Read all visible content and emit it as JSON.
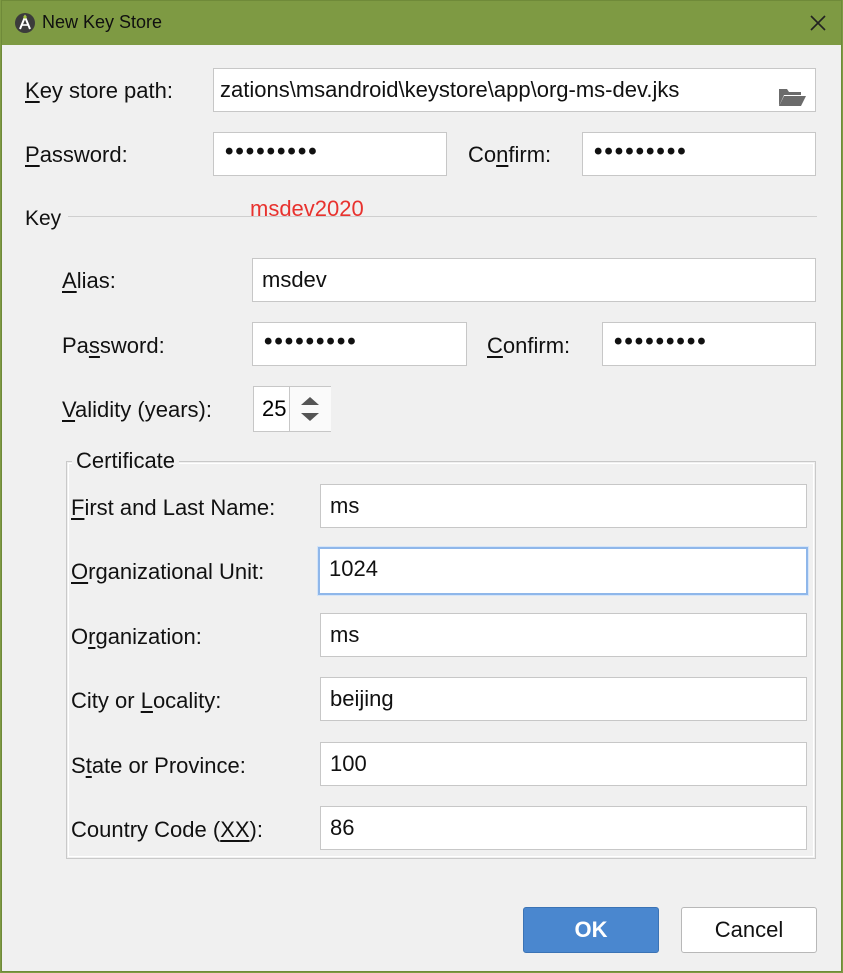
{
  "window": {
    "title": "New Key Store"
  },
  "keystore": {
    "path_label_prefix": "",
    "path_label_mnemonic": "K",
    "path_label_rest": "ey store path:",
    "path_value": "zations\\msandroid\\keystore\\app\\org-ms-dev.jks",
    "password_label_mnemonic": "P",
    "password_label_rest": "assword:",
    "password_value": "•••••••••",
    "confirm_label_a": "Co",
    "confirm_label_mnemonic": "n",
    "confirm_label_b": "firm:",
    "confirm_value": "•••••••••"
  },
  "annotation": "msdev2020",
  "key": {
    "section_label": "Key",
    "alias_label_mnemonic": "A",
    "alias_label_rest": "lias:",
    "alias_value": "msdev",
    "password_label_a": "Pa",
    "password_label_mnemonic": "s",
    "password_label_b": "sword:",
    "password_value": "•••••••••",
    "confirm_label_mnemonic": "C",
    "confirm_label_rest": "onfirm:",
    "confirm_value": "•••••••••",
    "validity_label_mnemonic": "V",
    "validity_label_rest": "alidity (years):",
    "validity_value": "25"
  },
  "certificate": {
    "title": "Certificate",
    "fields": [
      {
        "label_a": "",
        "mnemonic": "F",
        "label_b": "irst and Last Name:",
        "value": "ms"
      },
      {
        "label_a": "",
        "mnemonic": "O",
        "label_b": "rganizational Unit:",
        "value": "1024"
      },
      {
        "label_a": "O",
        "mnemonic": "r",
        "label_b": "ganization:",
        "value": "ms"
      },
      {
        "label_a": "City or ",
        "mnemonic": "L",
        "label_b": "ocality:",
        "value": "beijing"
      },
      {
        "label_a": "S",
        "mnemonic": "t",
        "label_b": "ate or Province:",
        "value": "100"
      },
      {
        "label_a": "Country Code (",
        "mnemonic": "XX",
        "label_b": "):",
        "value": "86"
      }
    ]
  },
  "buttons": {
    "ok": "OK",
    "cancel": "Cancel"
  },
  "colors": {
    "titlebar": "#7e9a43",
    "ok": "#4a87cf",
    "annotation": "#e8322e",
    "focus": "#8fb7ea"
  }
}
